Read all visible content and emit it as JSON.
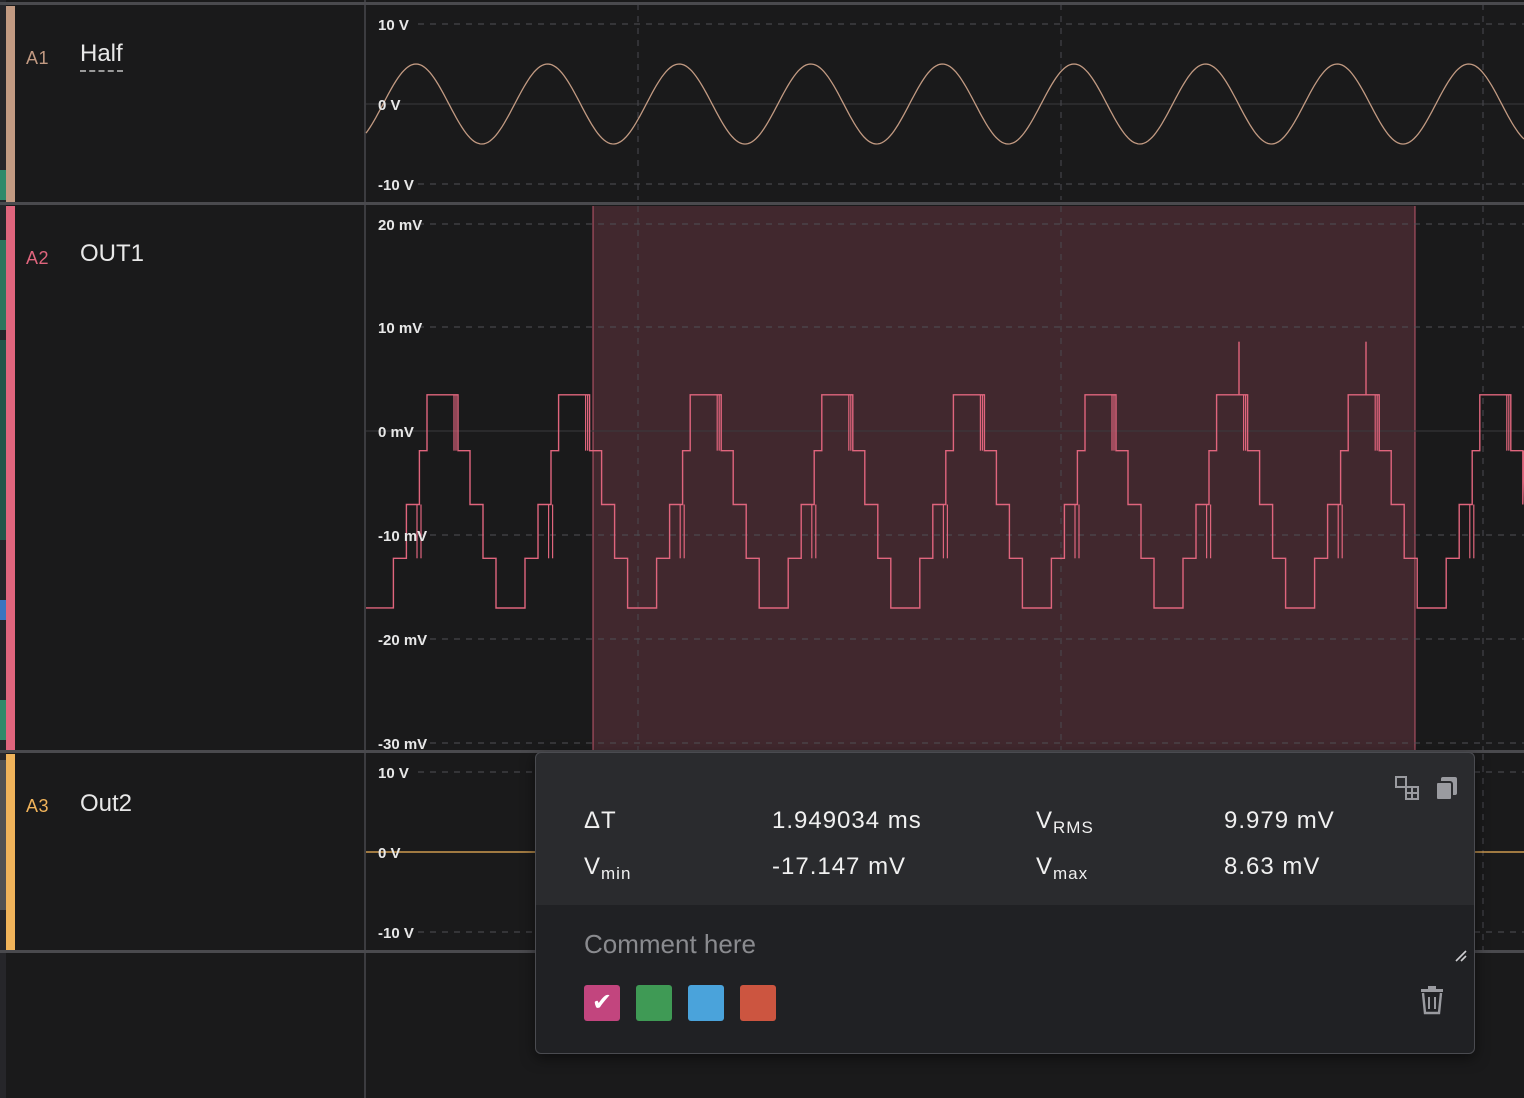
{
  "channels": [
    {
      "id": "A1",
      "name": "Half",
      "color": "#c29a82",
      "axis_labels": [
        "10 V",
        "0 V",
        "-10 V"
      ]
    },
    {
      "id": "A2",
      "name": "OUT1",
      "color": "#e0657d",
      "axis_labels": [
        "20 mV",
        "10 mV",
        "0 mV",
        "-10 mV",
        "-20 mV",
        "-30 mV"
      ]
    },
    {
      "id": "A3",
      "name": "Out2",
      "color": "#f0b35a",
      "axis_labels": [
        "10 V",
        "0 V",
        "-10 V"
      ]
    }
  ],
  "selection": {
    "color": "#e0657d"
  },
  "measurement_popup": {
    "delta_t": {
      "label": "ΔT",
      "value": "1.949034 ms"
    },
    "v_rms": {
      "label_main": "V",
      "label_sub": "RMS",
      "value": "9.979 mV"
    },
    "v_min": {
      "label_main": "V",
      "label_sub": "min",
      "value": "-17.147 mV"
    },
    "v_max": {
      "label_main": "V",
      "label_sub": "max",
      "value": "8.63 mV"
    },
    "comment_placeholder": "Comment here",
    "colors": [
      {
        "name": "pink",
        "hex": "#c2457e",
        "selected": true
      },
      {
        "name": "green",
        "hex": "#3f9a55",
        "selected": false
      },
      {
        "name": "blue",
        "hex": "#4aa3db",
        "selected": false
      },
      {
        "name": "red",
        "hex": "#cc5540",
        "selected": false
      }
    ],
    "icons": [
      "layout-icon",
      "copy-icon",
      "resize-grip-icon",
      "trash-icon"
    ]
  }
}
